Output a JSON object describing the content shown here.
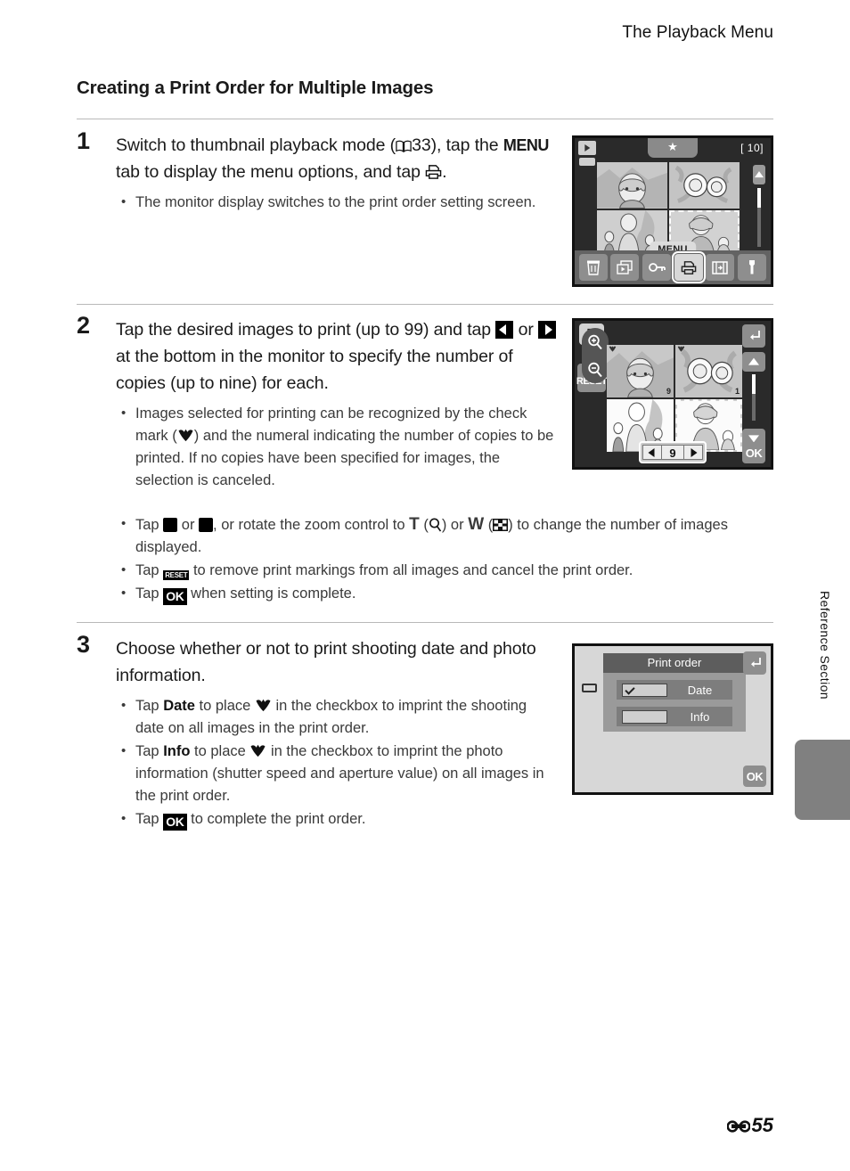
{
  "page": {
    "running_header": "The Playback Menu",
    "section_heading": "Creating a Print Order for Multiple Images",
    "side_label": "Reference Section",
    "page_number": "55",
    "page_prefix_icon": "reference-section-icon"
  },
  "steps": [
    {
      "number": "1",
      "lead_parts": {
        "a": "Switch to thumbnail playback mode (",
        "ref": "33",
        "b": "), tap the ",
        "menu": "MENU",
        "c": " tab to display the menu options, and tap ",
        "d": "."
      },
      "bullets": [
        {
          "text": "The monitor display switches to the print order setting screen."
        }
      ]
    },
    {
      "number": "2",
      "lead_parts": {
        "a": "Tap the desired images to print (up to 99) and tap ",
        "b": " or ",
        "c": " at the bottom in the monitor to specify the number of copies (up to nine) for each."
      },
      "bullets": [
        {
          "text_a": "Images selected for printing can be recognized by the check mark (",
          "text_b": ") and the numeral indicating the number of copies to be printed. If no copies have been specified for images, the selection is canceled."
        }
      ],
      "wide_bullets": [
        {
          "a": "Tap ",
          "b": " or ",
          "c": ", or rotate the zoom control to ",
          "t": "T",
          "d": " (",
          "e": ") or ",
          "w": "W",
          "f": " (",
          "g": ") to change the number of images displayed."
        },
        {
          "a": "Tap ",
          "reset": "RESET",
          "b": " to remove print markings from all images and cancel the print order."
        },
        {
          "a": "Tap ",
          "ok": "OK",
          "b": " when setting is complete."
        }
      ]
    },
    {
      "number": "3",
      "lead": "Choose whether or not to print shooting date and photo information.",
      "bullets": [
        {
          "a": "Tap ",
          "bold": "Date",
          "b": " to place ",
          "c": " in the checkbox to imprint the shooting date on all images in the print order."
        },
        {
          "a": "Tap ",
          "bold": "Info",
          "b": " to place ",
          "c": " in the checkbox to imprint the photo information (shutter speed and aperture value) on all images in the print order."
        },
        {
          "a": "Tap ",
          "ok": "OK",
          "b": " to complete the print order."
        }
      ]
    }
  ],
  "screens": {
    "screen1": {
      "name": "thumbnail-playback-menu-screen",
      "status_icons": [
        "playback-mode-icon",
        "battery-icon"
      ],
      "star_tab": "★",
      "frame_count": "[  10]",
      "menu_pill_label": "MENU",
      "menu_buttons": [
        {
          "name": "delete-button",
          "icon": "trash-icon",
          "active": false
        },
        {
          "name": "slideshow-button",
          "icon": "slideshow-icon",
          "active": false
        },
        {
          "name": "protect-button",
          "icon": "key-icon",
          "active": false
        },
        {
          "name": "print-order-button",
          "icon": "printer-icon",
          "active": true
        },
        {
          "name": "resize-button",
          "icon": "resize-icon",
          "active": false
        },
        {
          "name": "setup-button",
          "icon": "wrench-icon",
          "active": false
        }
      ]
    },
    "screen2": {
      "name": "print-order-selection-screen",
      "status_icons": [
        "printer-icon",
        "battery-icon"
      ],
      "reset_label": "RESET",
      "zoom_buttons": [
        "zoom-in-icon",
        "zoom-out-icon"
      ],
      "thumbnails": [
        {
          "copies": "9",
          "checked": true
        },
        {
          "copies": "1",
          "checked": true
        },
        {
          "copies": "",
          "checked": false
        },
        {
          "copies": "",
          "checked": false
        }
      ],
      "counter_value": "9",
      "right_buttons": [
        "back-icon",
        "scroll-up-icon",
        "scroll-down-icon",
        "ok-button"
      ],
      "ok_label": "OK"
    },
    "screen3": {
      "name": "print-order-options-dialog",
      "title": "Print order",
      "options": [
        {
          "label": "Date",
          "checked": true
        },
        {
          "label": "Info",
          "checked": false
        }
      ],
      "back_label": "back-icon",
      "ok_label": "OK"
    }
  },
  "colors": {
    "rule": "#b9b9b9",
    "screen_bg": "#2a2a2a",
    "menubar": "#636363",
    "dialog_title": "#5d5d5d",
    "dialog_body": "#9a9a9a",
    "side_tab": "#808080"
  }
}
